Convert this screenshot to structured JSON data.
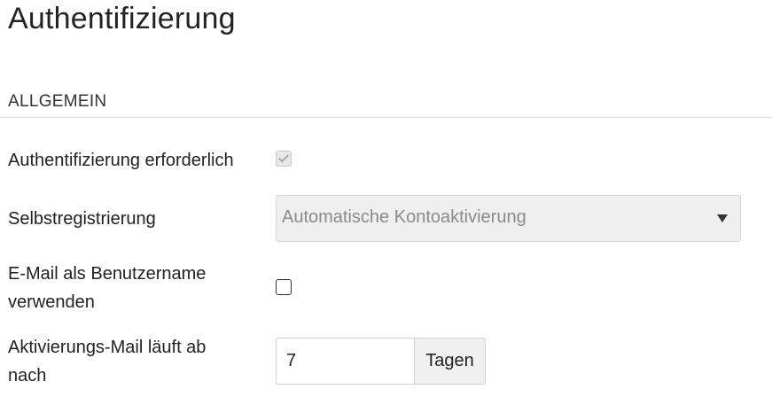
{
  "page": {
    "title": "Authentifizierung"
  },
  "section": {
    "header": "ALLGEMEIN"
  },
  "fields": {
    "auth_required": {
      "label": "Authentifizierung erforderlich",
      "checked": true,
      "disabled": true
    },
    "self_registration": {
      "label": "Selbstregistrierung",
      "selected_value": "Automatische Kontoaktivierung",
      "disabled": true
    },
    "email_as_username": {
      "label_line1": "E-Mail als Benutzername",
      "label_line2": "verwenden",
      "checked": false
    },
    "activation_mail_expiry": {
      "label_line1": "Aktivierungs-Mail läuft ab",
      "label_line2": "nach",
      "value": "7",
      "unit": "Tagen"
    }
  }
}
